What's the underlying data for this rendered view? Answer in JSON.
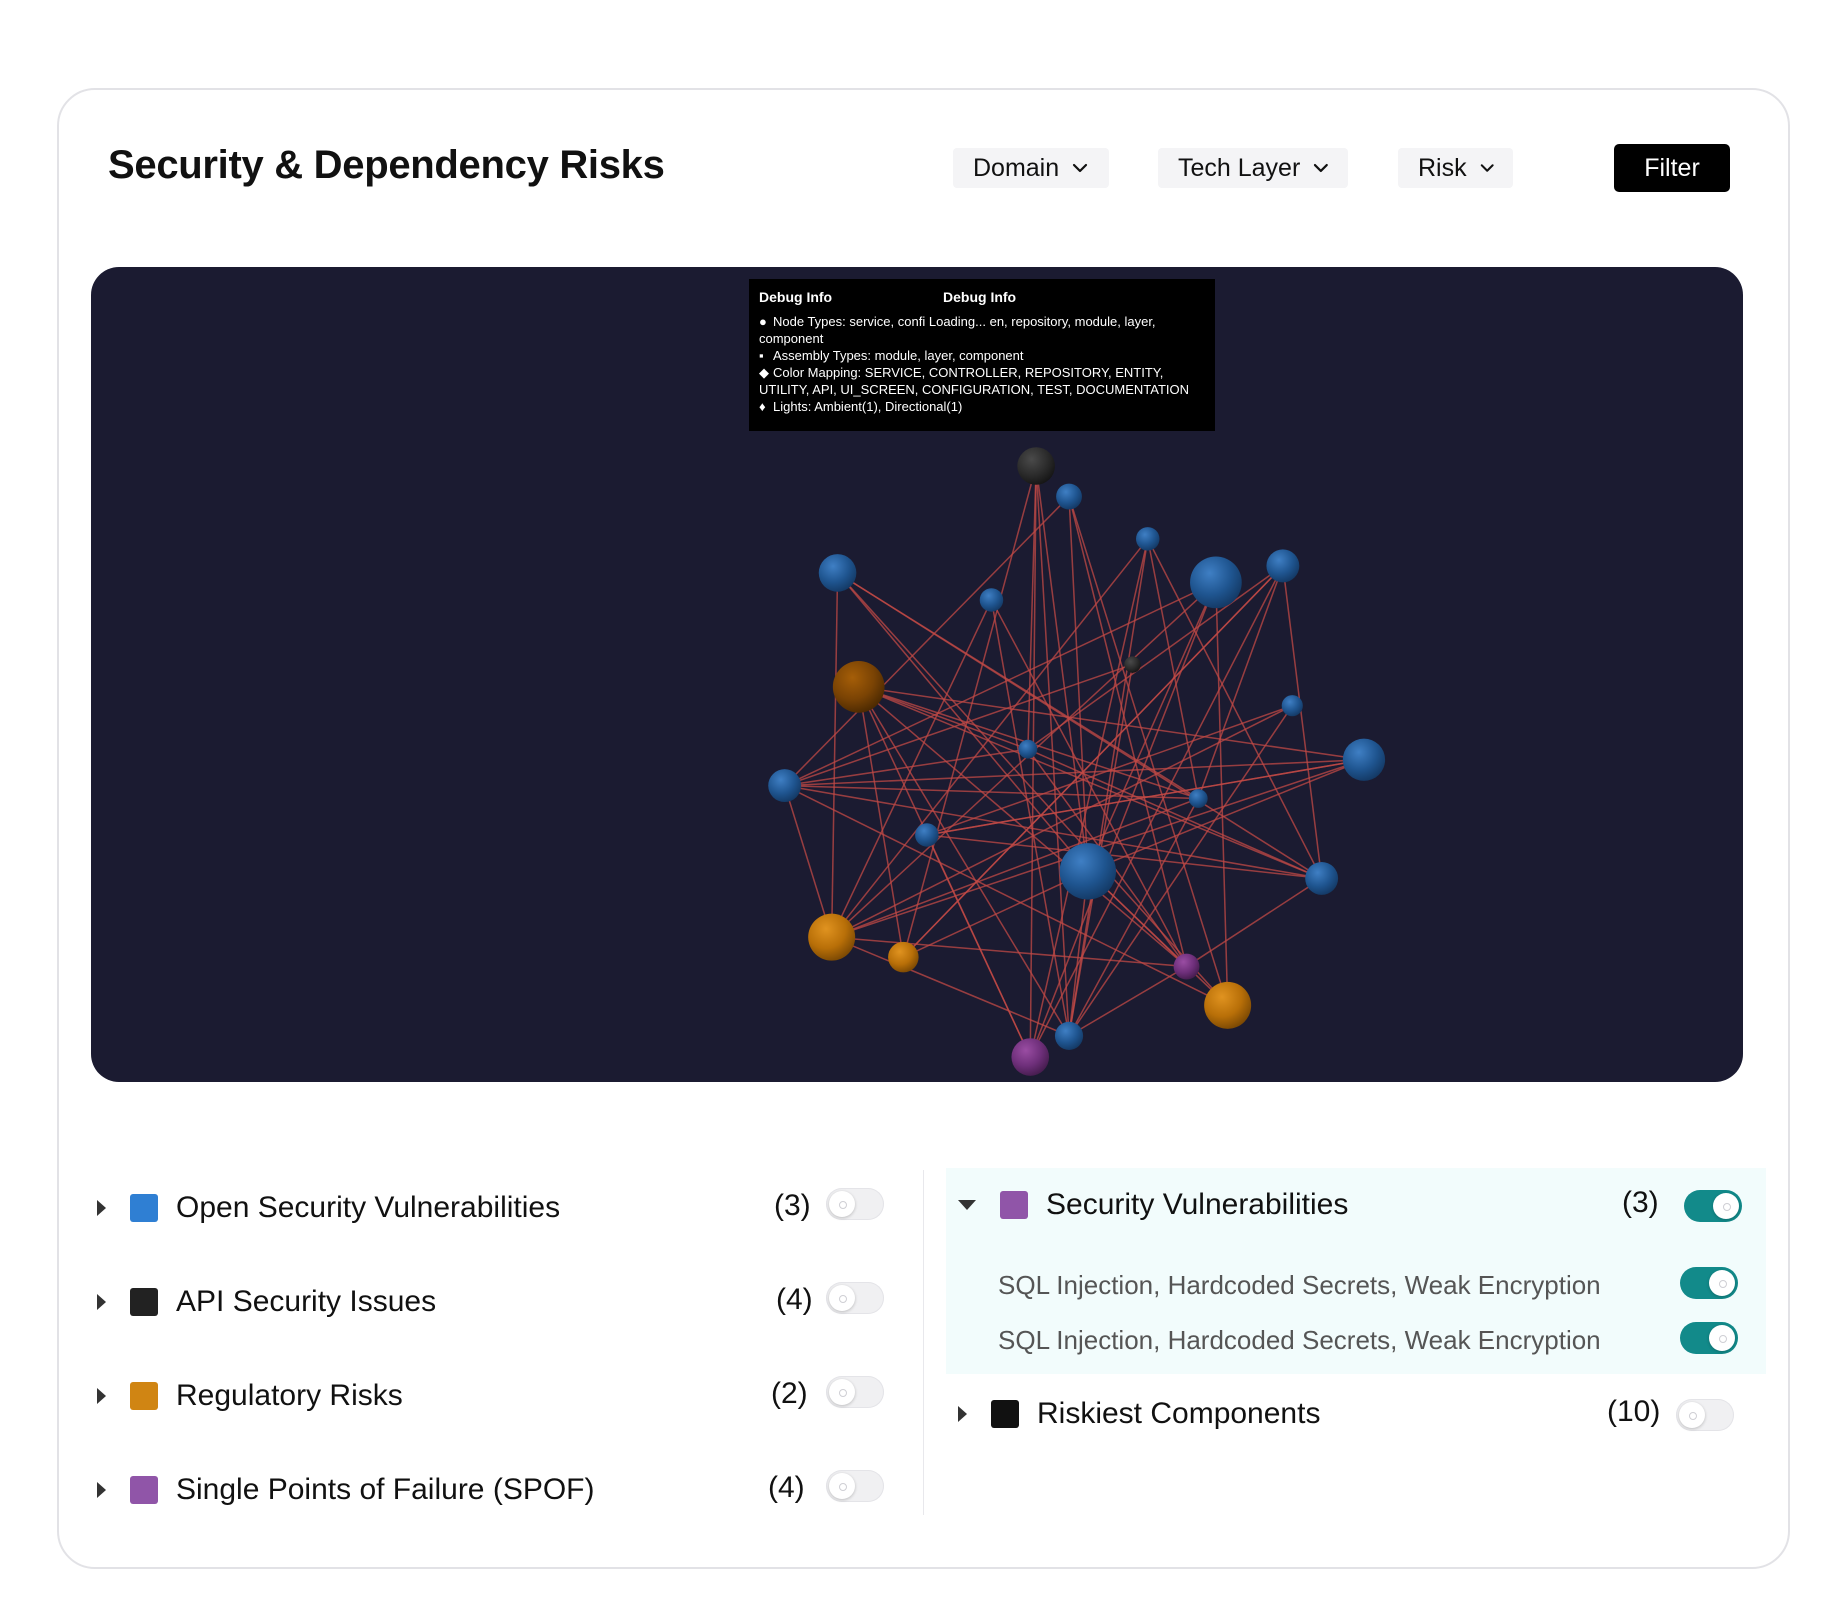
{
  "header": {
    "title": "Security & Dependency Risks",
    "filters": [
      {
        "label": "Domain"
      },
      {
        "label": "Tech Layer"
      },
      {
        "label": "Risk"
      }
    ],
    "filter_button": "Filter"
  },
  "debug": {
    "title_left": "Debug Info",
    "title_right": "Debug Info",
    "line1_a": "Node Types: service, confi",
    "line1_b": "Loading...",
    "line1_c": "en, repository, module, layer,",
    "line1d": "component",
    "line2": "Assembly Types: module, layer, component",
    "line3": "Color Mapping: SERVICE, CONTROLLER, REPOSITORY, ENTITY,",
    "line3b": "UTILITY, API, UI_SCREEN, CONFIGURATION, TEST, DOCUMENTATION",
    "line4": "Lights: Ambient(1), Directional(1)"
  },
  "colors": {
    "blue": "#2f7fd3",
    "black": "#222222",
    "orange": "#d08513",
    "purple": "#9055a8",
    "toggle_on": "#128a8a",
    "graph_bg": "#1b1b31",
    "edge": "#c24a45"
  },
  "left_categories": [
    {
      "label": "Open Security Vulnerabilities",
      "count": "(3)",
      "color": "#2f7fd3",
      "enabled": false
    },
    {
      "label": "API Security Issues",
      "count": "(4)",
      "color": "#222222",
      "enabled": false
    },
    {
      "label": "Regulatory Risks",
      "count": "(2)",
      "color": "#d08513",
      "enabled": false
    },
    {
      "label": "Single Points of Failure (SPOF)",
      "count": "(4)",
      "color": "#9055a8",
      "enabled": false
    }
  ],
  "right_categories": [
    {
      "label": "Security Vulnerabilities",
      "count": "(3)",
      "color": "#9055a8",
      "enabled": true,
      "expanded": true,
      "items": [
        {
          "label": "SQL Injection, Hardcoded Secrets, Weak Encryption",
          "enabled": true
        },
        {
          "label": "SQL Injection, Hardcoded Secrets, Weak Encryption",
          "enabled": true
        }
      ]
    },
    {
      "label": "Riskiest Components",
      "count": "(10)",
      "color": "#111111",
      "enabled": false,
      "expanded": false
    }
  ]
}
